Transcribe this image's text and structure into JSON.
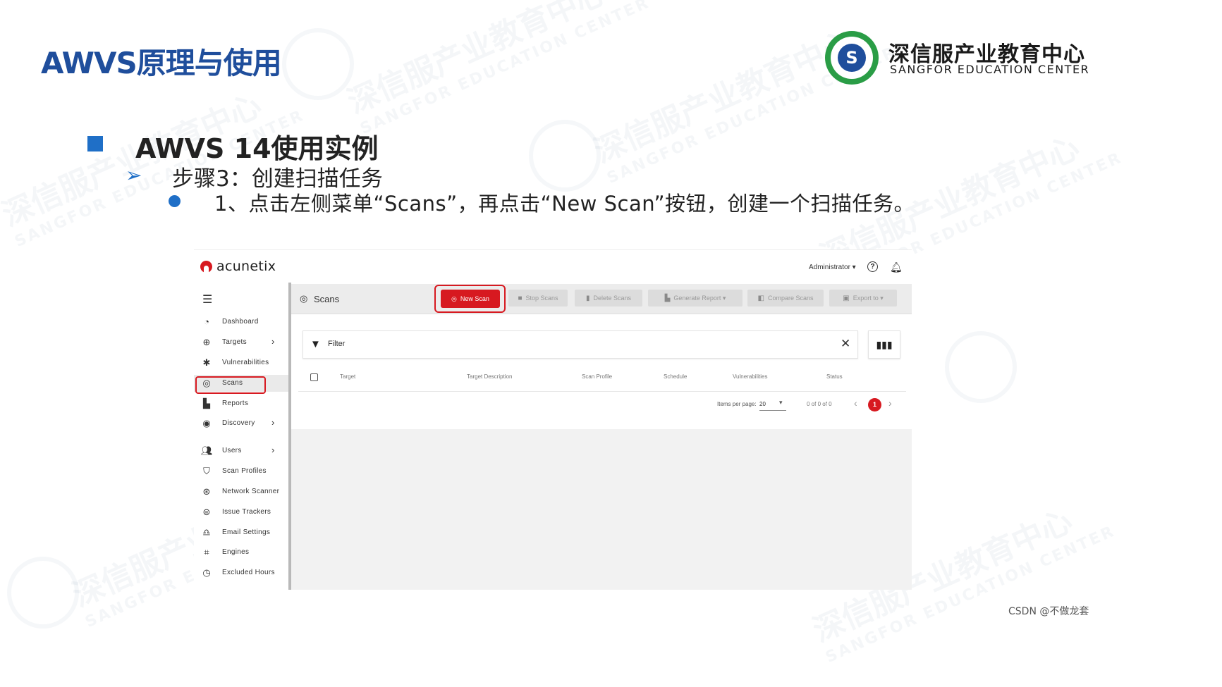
{
  "slide": {
    "title": "AWVS原理与使用",
    "org_cn": "深信服产业教育中心",
    "org_en": "SANGFOR EDUCATION CENTER",
    "heading": "AWVS 14使用实例",
    "subheading": "步骤3：创建扫描任务",
    "instruction": "1、点击左侧菜单“Scans”，再点击“New Scan”按钮，创建一个扫描任务。",
    "footer": "CSDN @不做龙套",
    "accent_color": "#1f4e9c",
    "bullet_color": "#1f6fc7"
  },
  "app": {
    "brand": "acunetix",
    "user": "Administrator ▾",
    "brand_color": "#d71920",
    "sidebar": [
      {
        "label": "Dashboard",
        "icon": "gauge-icon",
        "has_children": false
      },
      {
        "label": "Targets",
        "icon": "target-icon",
        "has_children": true
      },
      {
        "label": "Vulnerabilities",
        "icon": "bug-icon",
        "has_children": false
      },
      {
        "label": "Scans",
        "icon": "radar-icon",
        "has_children": false,
        "active": true
      },
      {
        "label": "Reports",
        "icon": "document-icon",
        "has_children": false
      },
      {
        "label": "Discovery",
        "icon": "compass-icon",
        "has_children": true
      },
      {
        "label": "Users",
        "icon": "users-icon",
        "has_children": true
      },
      {
        "label": "Scan Profiles",
        "icon": "shield-icon",
        "has_children": false
      },
      {
        "label": "Network Scanner",
        "icon": "network-icon",
        "has_children": false
      },
      {
        "label": "Issue Trackers",
        "icon": "tracker-icon",
        "has_children": false
      },
      {
        "label": "Email Settings",
        "icon": "bell-icon",
        "has_children": false
      },
      {
        "label": "Engines",
        "icon": "chip-icon",
        "has_children": false
      },
      {
        "label": "Excluded Hours",
        "icon": "clock-icon",
        "has_children": false
      }
    ],
    "page_title": "Scans",
    "toolbar": {
      "new_scan": "New Scan",
      "stop_scans": "Stop Scans",
      "delete_scans": "Delete Scans",
      "generate_report": "Generate Report ▾",
      "compare_scans": "Compare Scans",
      "export_to": "Export to ▾"
    },
    "filter_label": "Filter",
    "table_headers": [
      "Target",
      "Target Description",
      "Scan Profile",
      "Schedule",
      "Vulnerabilities",
      "Status"
    ],
    "pagination": {
      "items_per_page_label": "Items per page:",
      "items_per_page": "20",
      "range": "0 of 0 of 0",
      "current_page": "1"
    }
  }
}
